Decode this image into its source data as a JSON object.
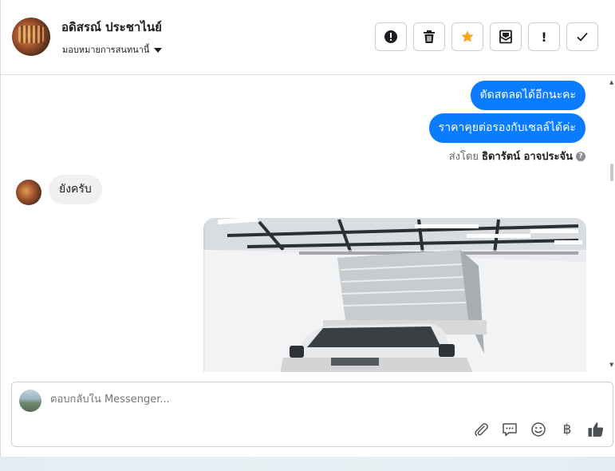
{
  "header": {
    "contact_name": "อดิสรณ์ ประชาไนย์",
    "assign_label": "มอบหมายการสนทนานี้",
    "actions": [
      {
        "icon": "alert-circle-icon"
      },
      {
        "icon": "trash-icon"
      },
      {
        "icon": "star-icon",
        "color": "#f5a623"
      },
      {
        "icon": "mark-unread-icon"
      },
      {
        "icon": "exclamation-icon",
        "glyph": "!"
      },
      {
        "icon": "checkmark-icon"
      }
    ]
  },
  "thread": {
    "outgoing": [
      {
        "text": "ตัดสตลดได้อีกนะคะ"
      },
      {
        "text": "ราคาคุยต่อรองกับเซลล์ได้ค่ะ"
      }
    ],
    "sent_by_prefix": "ส่งโดย",
    "sent_by_name": "ธิดารัตน์ อาจประจัน",
    "incoming": [
      {
        "text": "ยังครับ"
      }
    ]
  },
  "composer": {
    "placeholder": "ตอบกลับใน Messenger...",
    "tools": [
      "paperclip-icon",
      "chat-bubble-icon",
      "emoji-icon",
      "baht-icon",
      "thumbs-up-icon"
    ],
    "baht_glyph": "฿"
  },
  "colors": {
    "accent": "#0a7cff",
    "star": "#f5a623"
  }
}
